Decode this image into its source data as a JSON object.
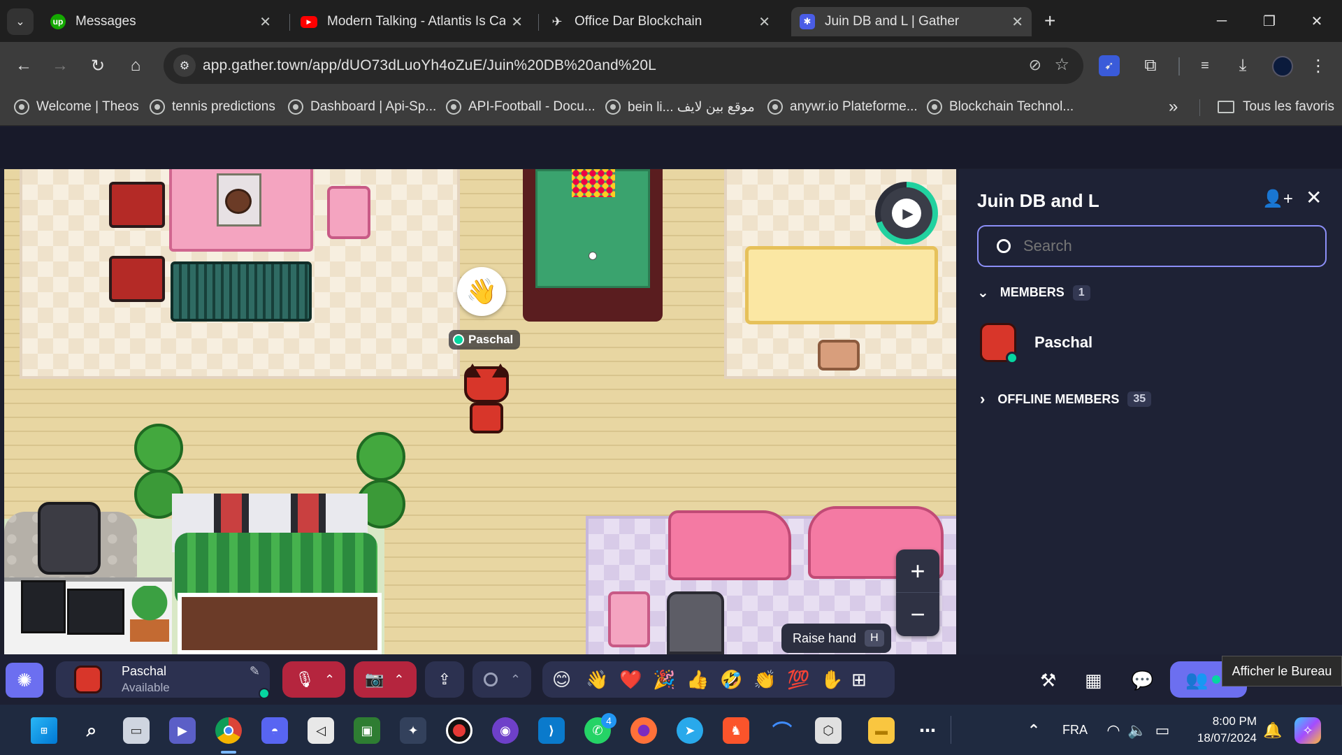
{
  "browser": {
    "tabs": [
      {
        "title": "Messages",
        "favicon": "upwork-icon"
      },
      {
        "title": "Modern Talking - Atlantis Is Calling",
        "favicon": "youtube-icon"
      },
      {
        "title": "Office Dar Blockchain",
        "favicon": "send-icon"
      },
      {
        "title": "Juin DB and L | Gather",
        "favicon": "gather-icon"
      }
    ],
    "url": "app.gather.town/app/dUO73dLuoYh4oZuE/Juin%20DB%20and%20L",
    "bookmarks": [
      "Welcome | Theos",
      "tennis predictions",
      "Dashboard | Api-Sp...",
      "API-Football - Docu...",
      "bein li... موقع بين لايف",
      "anywr.io Plateforme...",
      "Blockchain Technol..."
    ],
    "all_bookmarks": "Tous les favoris",
    "more": "»"
  },
  "game": {
    "player_name": "Paschal",
    "raise_hand_label": "Raise hand",
    "raise_hand_key": "H",
    "zoom_in": "+",
    "zoom_out": "−"
  },
  "panel": {
    "title": "Juin DB and L",
    "search_placeholder": "Search",
    "members_label": "MEMBERS",
    "members_count": "1",
    "member_name": "Paschal",
    "offline_label": "OFFLINE MEMBERS",
    "offline_count": "35"
  },
  "bottombar": {
    "user_name": "Paschal",
    "user_status": "Available",
    "tooltip": "Afficher le Bureau",
    "emojis": [
      "😊",
      "👋",
      "❤️",
      "🎉",
      "👍",
      "🤣",
      "👏",
      "💯"
    ]
  },
  "taskbar": {
    "lang": "FRA",
    "time": "8:00 PM",
    "date": "18/07/2024",
    "whatsapp_badge": "4"
  },
  "colors": {
    "accent": "#6c6ff0",
    "online": "#06d6a0",
    "muted_red": "#d9324a",
    "panel_bg": "#1e2235"
  }
}
